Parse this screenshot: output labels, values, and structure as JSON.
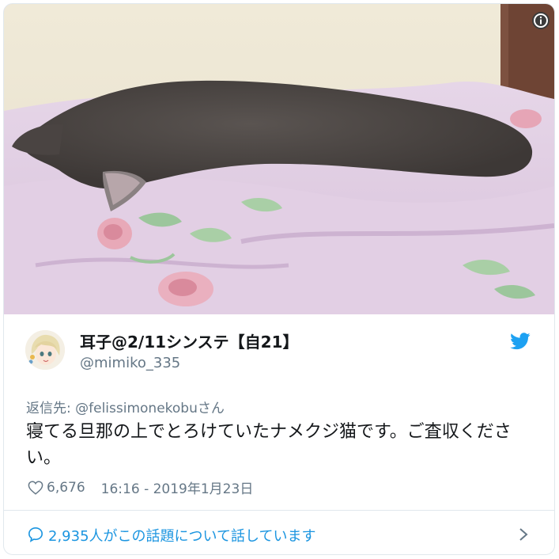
{
  "tweet": {
    "author_name": "耳子@2/11シンステ【自21】",
    "author_handle": "@mimiko_335",
    "reply_label": "返信先: ",
    "reply_mention": "@felissimonekobu",
    "reply_suffix": "さん",
    "text": "寝てる旦那の上でとろけていたナメクジ猫です。ご査収ください。",
    "likes": "6,676",
    "timestamp": "16:16 - 2019年1月23日",
    "footer_text": "2,935人がこの話題について話しています"
  },
  "icons": {
    "info": "info-icon",
    "platform": "twitter-bird-icon",
    "like": "heart-icon",
    "conversation": "speech-bubble-icon",
    "more": "chevron-right-icon"
  },
  "colors": {
    "link_blue": "#1b95e0",
    "secondary_text": "#657786",
    "twitter_blue": "#1da1f2"
  }
}
